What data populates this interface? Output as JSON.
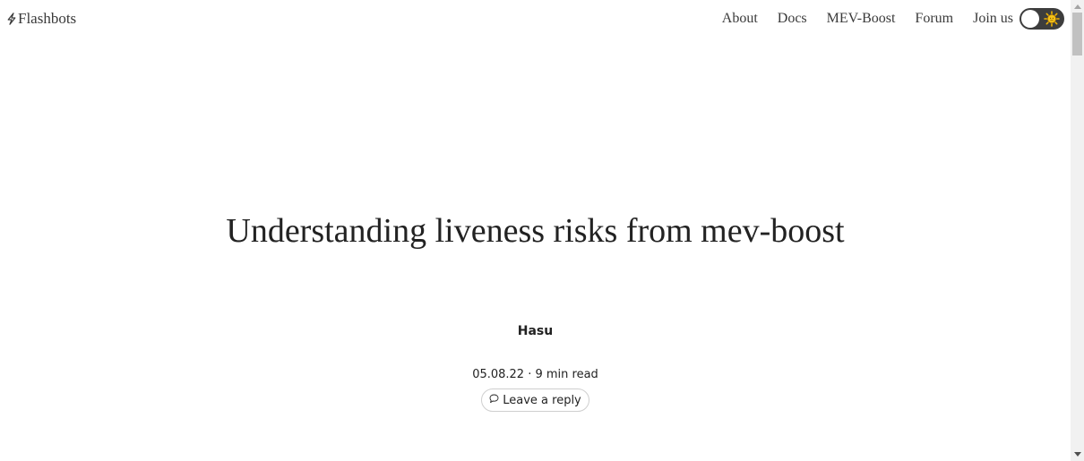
{
  "brand": {
    "name": "Flashbots",
    "icon": "lightning-bolt-icon"
  },
  "nav": {
    "items": [
      "About",
      "Docs",
      "MEV-Boost",
      "Forum",
      "Join us"
    ],
    "theme_toggle": {
      "icon": "sun-icon",
      "state": "light"
    }
  },
  "post": {
    "title": "Understanding liveness risks from mev-boost",
    "author": "Hasu",
    "meta": "05.08.22 · 9 min read",
    "reply_label": "Leave a reply",
    "reply_icon": "speech-bubble-icon"
  },
  "colors": {
    "text": "#222222",
    "nav_text": "#3a3a3a",
    "toggle_bg": "#3d3d3d",
    "sun": "#f0b400",
    "border": "#cfcfcf"
  }
}
